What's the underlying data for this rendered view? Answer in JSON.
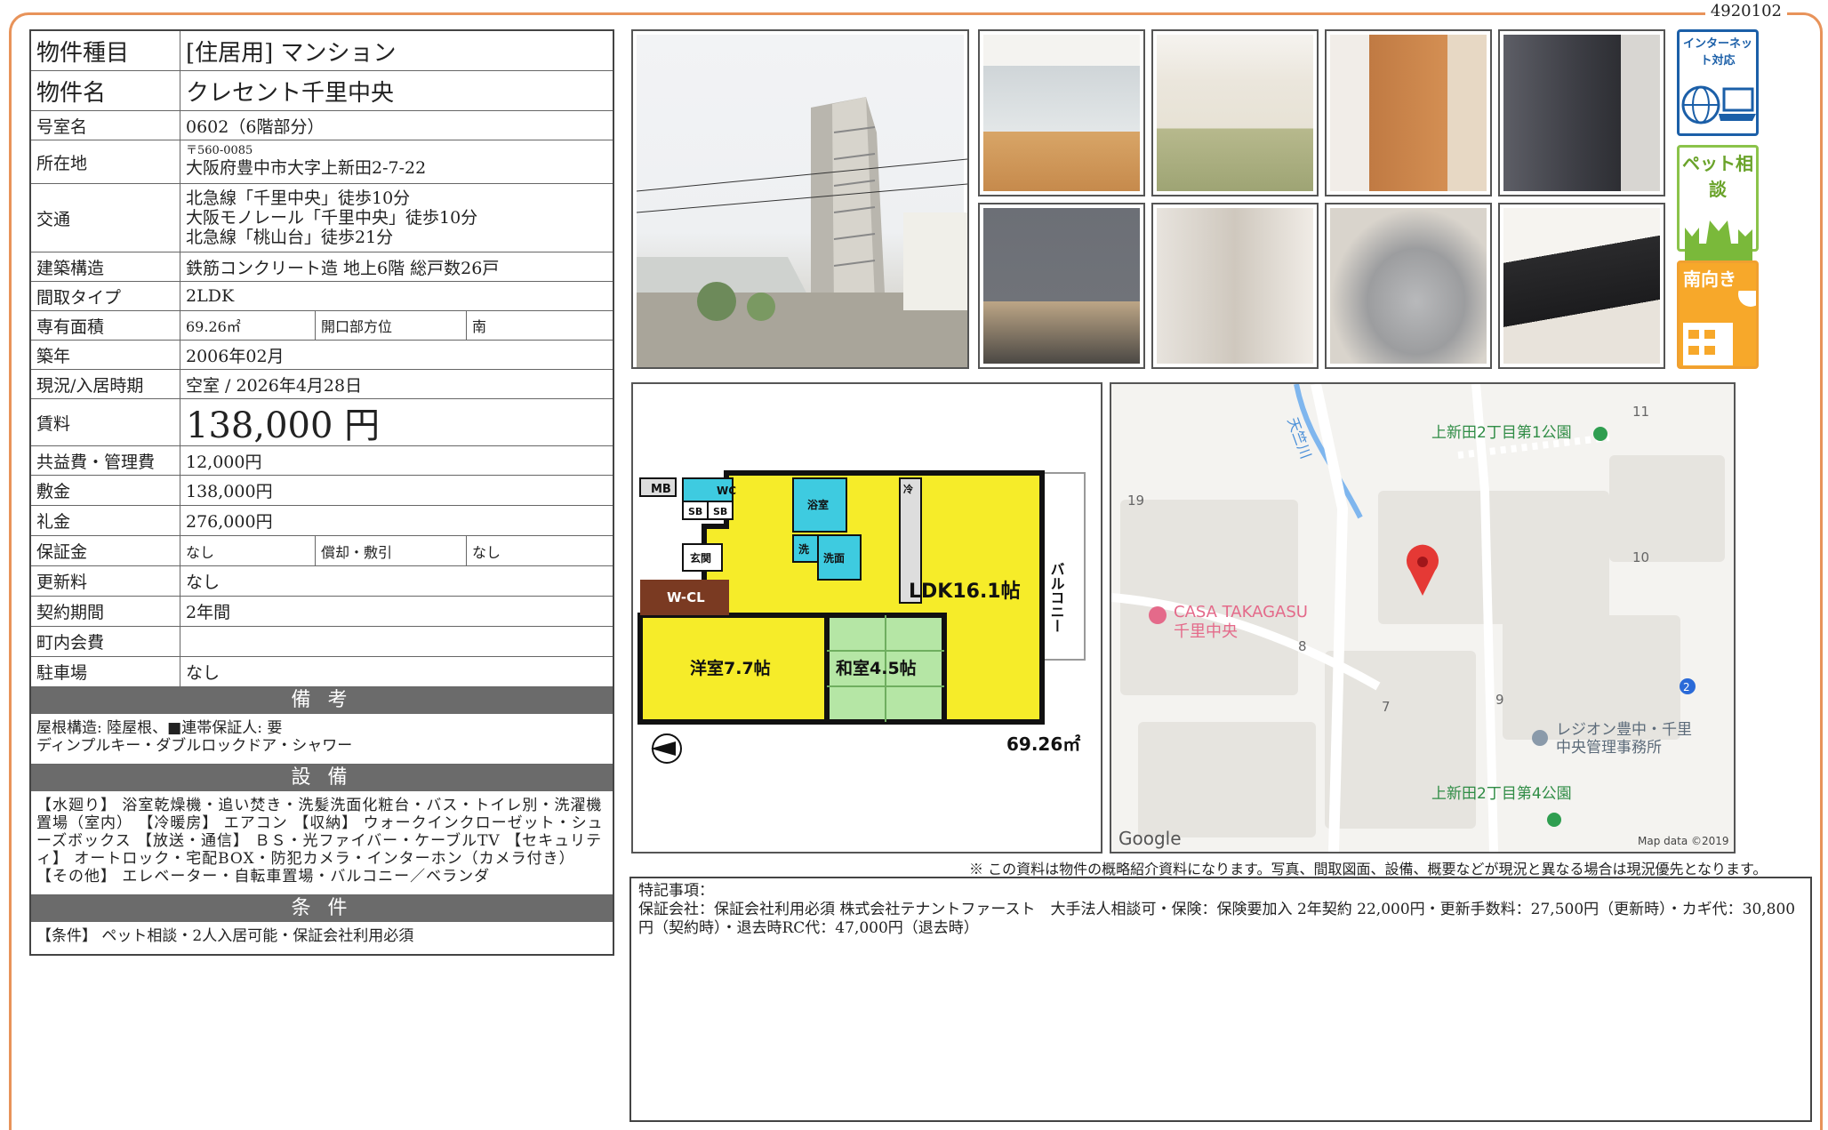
{
  "doc_id": "4920102",
  "info": {
    "type_label": "物件種目",
    "type_value": "[住居用]  マンション",
    "name_label": "物件名",
    "name_value": "クレセント千里中央",
    "room_label": "号室名",
    "room_value": "0602（6階部分）",
    "addr_label": "所在地",
    "addr_zip": "〒560-0085",
    "addr_value": "大阪府豊中市大字上新田2-7-22",
    "access_label": "交通",
    "access_1": "北急線「千里中央」徒歩10分",
    "access_2": "大阪モノレール「千里中央」徒歩10分",
    "access_3": "北急線「桃山台」徒歩21分",
    "struct_label": "建築構造",
    "struct_value": "鉄筋コンクリート造 地上6階  総戸数26戸",
    "layout_label": "間取タイプ",
    "layout_value": "2LDK",
    "area_label": "専有面積",
    "area_value": "69.26㎡",
    "dir_label": "開口部方位",
    "dir_value": "南",
    "built_label": "築年",
    "built_value": "2006年02月",
    "status_label": "現況/入居時期",
    "status_value": "空室  /  2026年4月28日",
    "rent_label": "賃料",
    "rent_value": "138,000 円",
    "fee_label": "共益費・管理費",
    "fee_value": "12,000円",
    "deposit_label": "敷金",
    "deposit_value": "138,000円",
    "key_label": "礼金",
    "key_value": "276,000円",
    "guar_label": "保証金",
    "guar_value": "なし",
    "amort_label": "償却・敷引",
    "amort_value": "なし",
    "renew_label": "更新料",
    "renew_value": "なし",
    "term_label": "契約期間",
    "term_value": "2年間",
    "town_label": "町内会費",
    "town_value": "",
    "park_label": "駐車場",
    "park_value": "なし"
  },
  "remarks": {
    "title": "備 考",
    "line1": "屋根構造: 陸屋根、■連帯保証人: 要",
    "line2": "ディンプルキー・ダブルロックドア・シャワー"
  },
  "equipment": {
    "title": "設 備",
    "text": "【水廻り】 浴室乾燥機・追い焚き・洗髪洗面化粧台・バス・トイレ別・洗濯機置場（室内） 【冷暖房】 エアコン 【収納】 ウォークインクローゼット・シューズボックス 【放送・通信】 ＢＳ・光ファイバー・ケーブルTV 【セキュリティ】 オートロック・宅配BOX・防犯カメラ・インターホン（カメラ付き） 【その他】 エレベーター・自転車置場・バルコニー／ベランダ"
  },
  "conditions": {
    "title": "条 件",
    "text": "【条件】 ペット相談・2人入居可能・保証会社利用必須"
  },
  "badges": {
    "internet": "インターネット対応",
    "pet": "ペット相談",
    "south": "南向き"
  },
  "floorplan": {
    "ldk": "LDK16.1帖",
    "western": "洋室7.7帖",
    "japanese": "和室4.5帖",
    "balcony": "バルコニー",
    "wcl": "W-CL",
    "mb": "MB",
    "wc": "WC",
    "sb1": "SB",
    "sb2": "SB",
    "bath": "浴室",
    "wash": "洗面",
    "sen": "洗",
    "entrance": "玄関",
    "rei": "冷",
    "area": "69.26㎡"
  },
  "map": {
    "river": "天竺川",
    "park1": "上新田2丁目第1公園",
    "park4": "上新田2丁目第4公園",
    "casa1": "CASA TAKAGASU",
    "casa2": "千里中央",
    "office1": "レジオン豊中・千里",
    "office2": "中央管理事務所",
    "n11": "11",
    "n19": "19",
    "n10": "10",
    "n8": "8",
    "n7": "7",
    "n9": "9",
    "n2": "2",
    "google": "Google",
    "mapdata": "Map data ©2019"
  },
  "footnote": "※ この資料は物件の概略紹介資料になります。写真、間取図面、設備、概要などが現況と異なる場合は現況優先となります。",
  "special": {
    "title": "特記事項：",
    "text": "保証会社：保証会社利用必須 株式会社テナントファースト　大手法人相談可・保険：保険要加入 2年契約 22,000円・更新手数料：27,500円（更新時）・カギ代：30,800円（契約時）・退去時RC代：47,000円（退去時）"
  }
}
